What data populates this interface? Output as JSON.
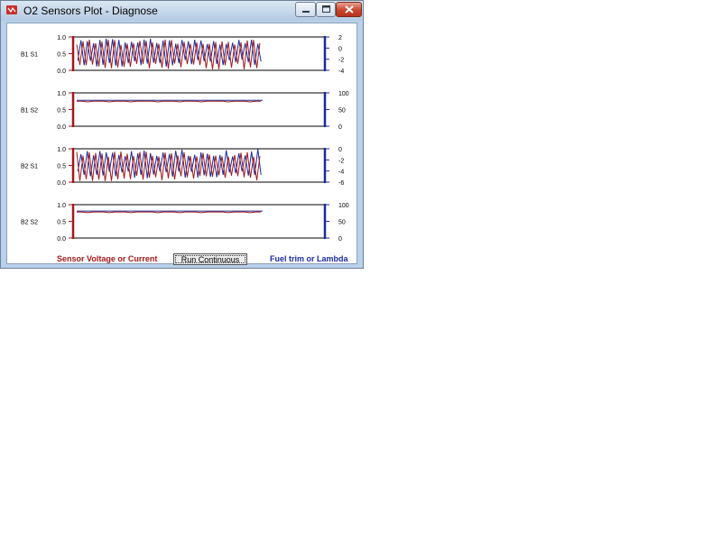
{
  "window": {
    "title": "O2 Sensors Plot - Diagnose"
  },
  "titlebar_icons": {
    "app": "app-icon",
    "minimize": "minimize-icon",
    "maximize": "maximize-icon",
    "close": "close-icon"
  },
  "colors": {
    "voltage": "#a2181a",
    "fuel_trim": "#1a2a9c",
    "frame": "#000000"
  },
  "plots": [
    {
      "id": "b1s1",
      "label": "B1 S1",
      "left_ticks": [
        "1.0",
        "0.5",
        "0.0"
      ],
      "right_ticks": [
        "2",
        "0",
        "-2",
        "-4"
      ],
      "right_range": [
        -4,
        2
      ],
      "mode": "oscillating",
      "voltage_level": 0.5,
      "trim_level": 0.5
    },
    {
      "id": "b1s2",
      "label": "B1 S2",
      "left_ticks": [
        "1.0",
        "0.5",
        "0.0"
      ],
      "right_ticks": [
        "100",
        "50",
        "0"
      ],
      "right_range": [
        0,
        100
      ],
      "mode": "steady",
      "voltage_level": 0.75,
      "trim_level": 0.75
    },
    {
      "id": "b2s1",
      "label": "B2 S1",
      "left_ticks": [
        "1.0",
        "0.5",
        "0.0"
      ],
      "right_ticks": [
        "0",
        "-2",
        "-4",
        "-6"
      ],
      "right_range": [
        -6,
        0
      ],
      "mode": "oscillating",
      "voltage_level": 0.5,
      "trim_level": 0.5
    },
    {
      "id": "b2s2",
      "label": "B2 S2",
      "left_ticks": [
        "1.0",
        "0.5",
        "0.0"
      ],
      "right_ticks": [
        "100",
        "50",
        "0"
      ],
      "right_range": [
        0,
        100
      ],
      "mode": "steady",
      "voltage_level": 0.78,
      "trim_level": 0.78
    }
  ],
  "footer": {
    "left_label": "Sensor Voltage or Current",
    "button_label": "Run Continuous",
    "right_label": "Fuel trim or Lambda"
  }
}
